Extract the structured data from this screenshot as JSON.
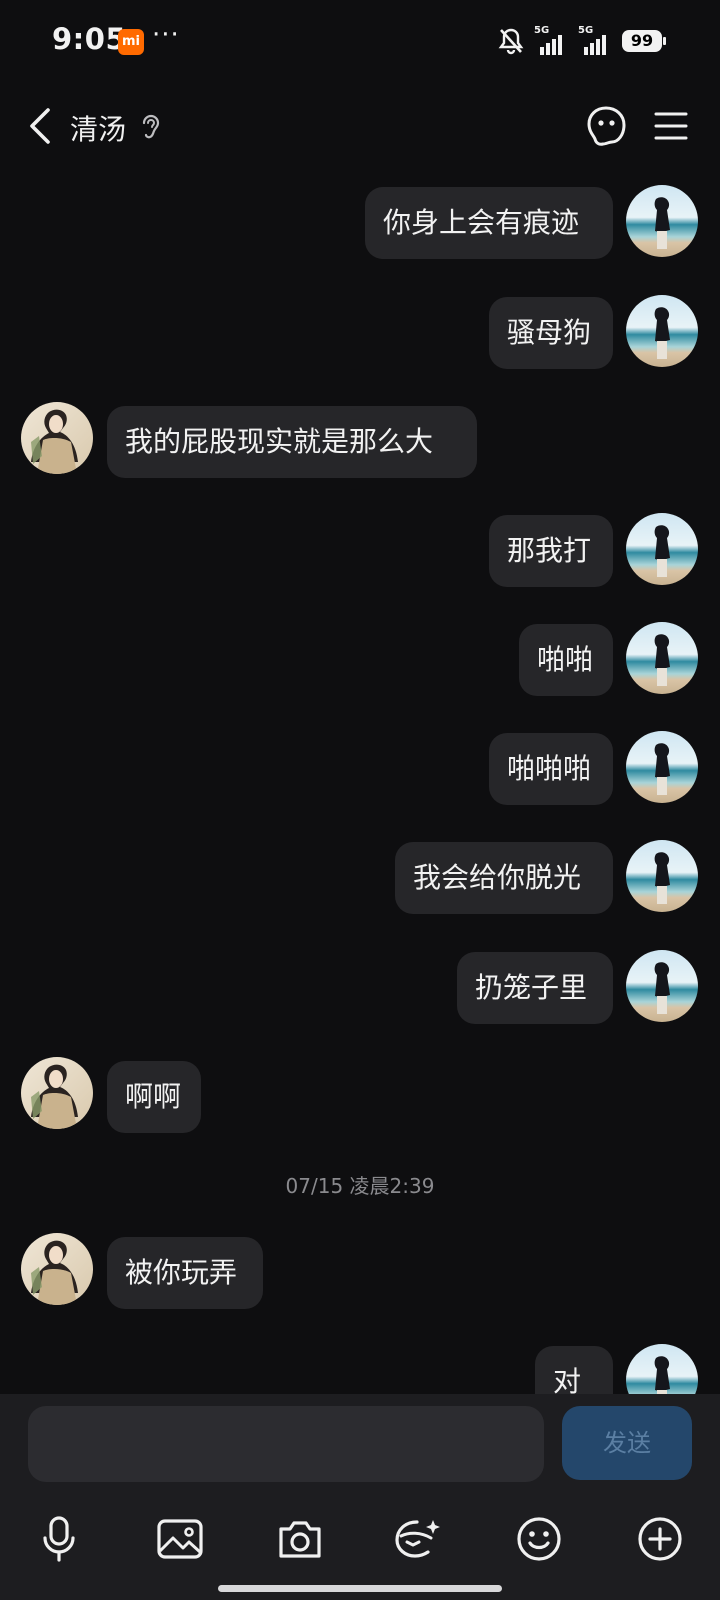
{
  "status_bar": {
    "time": "9:05",
    "mi_badge": "mi",
    "more": "···",
    "net1": "5G",
    "net2": "5G",
    "battery": "99"
  },
  "header": {
    "title": "清汤"
  },
  "messages": [
    {
      "side": "right",
      "text": "你身上会有痕迹"
    },
    {
      "side": "right",
      "text": "骚母狗"
    },
    {
      "side": "left",
      "text": "我的屁股现实就是那么大"
    },
    {
      "side": "right",
      "text": "那我打"
    },
    {
      "side": "right",
      "text": "啪啪"
    },
    {
      "side": "right",
      "text": "啪啪啪"
    },
    {
      "side": "right",
      "text": "我会给你脱光"
    },
    {
      "side": "right",
      "text": "扔笼子里"
    },
    {
      "side": "left",
      "text": "啊啊"
    },
    {
      "side": "left",
      "text": "被你玩弄"
    },
    {
      "side": "right",
      "text": "对"
    }
  ],
  "timestamp": "07/15 凌晨2:39",
  "input": {
    "value": "",
    "placeholder": "",
    "send_label": "发送"
  },
  "toolbar_icons": [
    "mic-icon",
    "image-icon",
    "camera-icon",
    "sticker-icon",
    "emoji-icon",
    "plus-icon"
  ],
  "colors": {
    "background": "#0e0e10",
    "bubble": "#262629",
    "send_button": "#24476b",
    "accent_badge": "#ff6a00"
  }
}
